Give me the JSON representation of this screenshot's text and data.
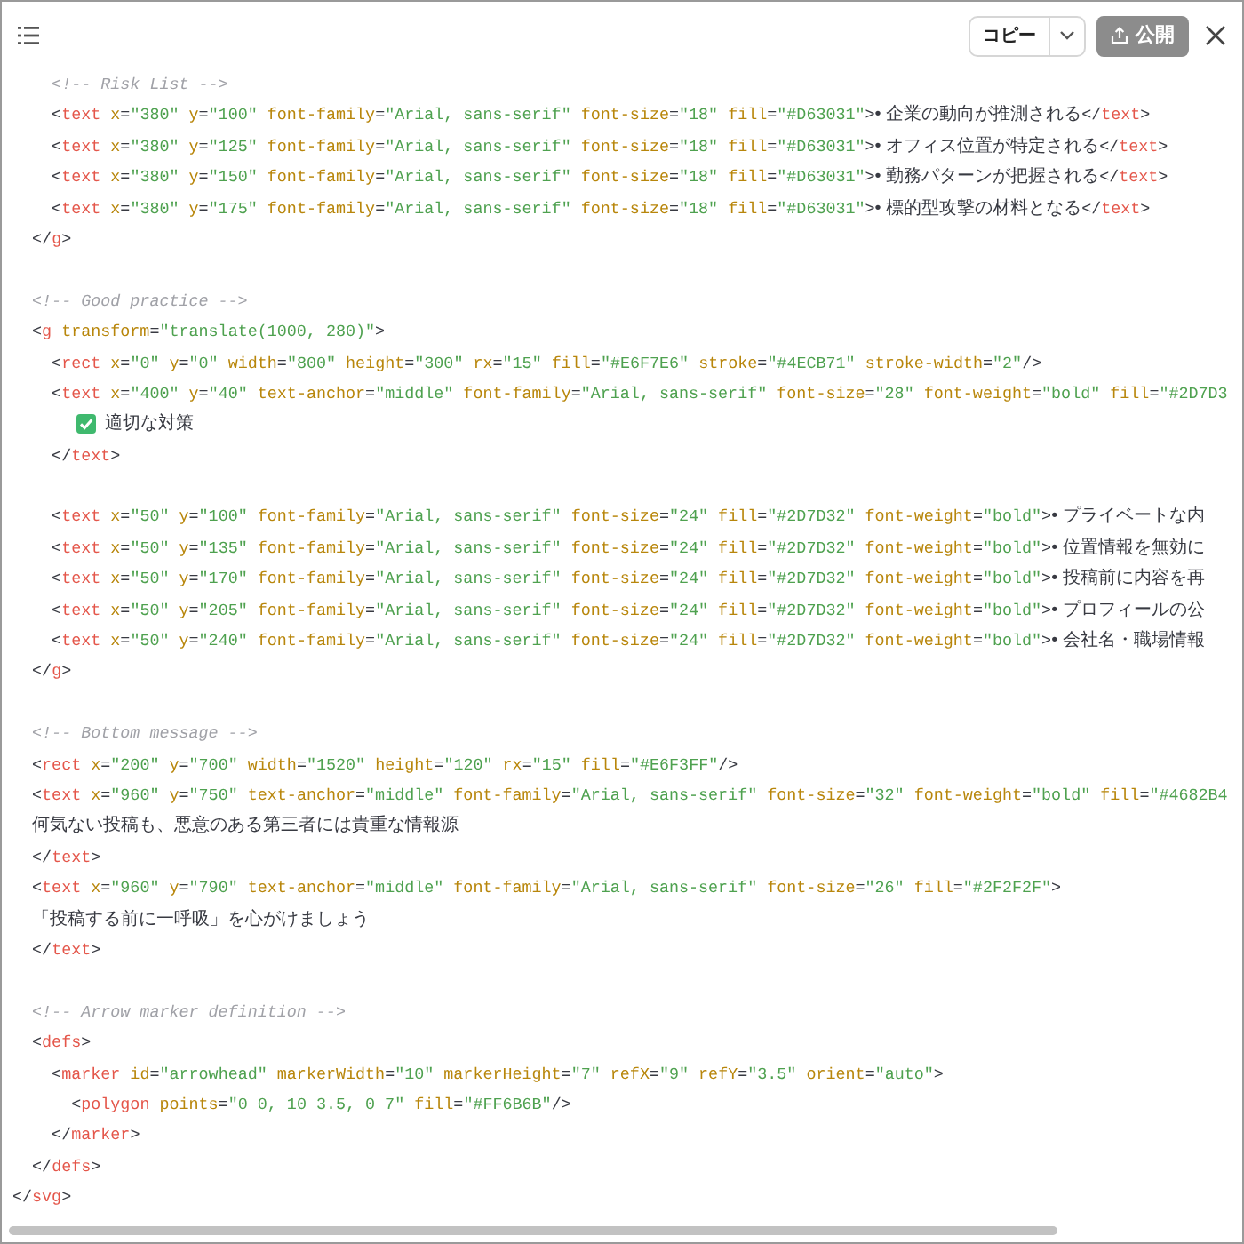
{
  "toolbar": {
    "copy_button": "コピー",
    "publish_button": "公開"
  },
  "code_lines": [
    {
      "kind": "code",
      "tokens": [
        {
          "kind": "comment",
          "text": "    <!-- Risk List -->"
        }
      ]
    },
    {
      "kind": "code",
      "tokens": [
        {
          "kind": "punct",
          "text": "    <"
        },
        {
          "kind": "tag",
          "text": "text"
        },
        {
          "kind": "attr",
          "text": " x"
        },
        {
          "kind": "punct",
          "text": "="
        },
        {
          "kind": "value",
          "text": "\"380\""
        },
        {
          "kind": "attr",
          "text": " y"
        },
        {
          "kind": "punct",
          "text": "="
        },
        {
          "kind": "value",
          "text": "\"100\""
        },
        {
          "kind": "attr",
          "text": " font-family"
        },
        {
          "kind": "punct",
          "text": "="
        },
        {
          "kind": "value",
          "text": "\"Arial, sans-serif\""
        },
        {
          "kind": "attr",
          "text": " font-size"
        },
        {
          "kind": "punct",
          "text": "="
        },
        {
          "kind": "value",
          "text": "\"18\""
        },
        {
          "kind": "attr",
          "text": " fill"
        },
        {
          "kind": "punct",
          "text": "="
        },
        {
          "kind": "value",
          "text": "\"#D63031\""
        },
        {
          "kind": "punct",
          "text": ">"
        },
        {
          "kind": "text",
          "text": "• 企業の動向が推測される"
        },
        {
          "kind": "punct",
          "text": "</"
        },
        {
          "kind": "tag",
          "text": "text"
        },
        {
          "kind": "punct",
          "text": ">"
        }
      ]
    },
    {
      "kind": "code",
      "tokens": [
        {
          "kind": "punct",
          "text": "    <"
        },
        {
          "kind": "tag",
          "text": "text"
        },
        {
          "kind": "attr",
          "text": " x"
        },
        {
          "kind": "punct",
          "text": "="
        },
        {
          "kind": "value",
          "text": "\"380\""
        },
        {
          "kind": "attr",
          "text": " y"
        },
        {
          "kind": "punct",
          "text": "="
        },
        {
          "kind": "value",
          "text": "\"125\""
        },
        {
          "kind": "attr",
          "text": " font-family"
        },
        {
          "kind": "punct",
          "text": "="
        },
        {
          "kind": "value",
          "text": "\"Arial, sans-serif\""
        },
        {
          "kind": "attr",
          "text": " font-size"
        },
        {
          "kind": "punct",
          "text": "="
        },
        {
          "kind": "value",
          "text": "\"18\""
        },
        {
          "kind": "attr",
          "text": " fill"
        },
        {
          "kind": "punct",
          "text": "="
        },
        {
          "kind": "value",
          "text": "\"#D63031\""
        },
        {
          "kind": "punct",
          "text": ">"
        },
        {
          "kind": "text",
          "text": "• オフィス位置が特定される"
        },
        {
          "kind": "punct",
          "text": "</"
        },
        {
          "kind": "tag",
          "text": "text"
        },
        {
          "kind": "punct",
          "text": ">"
        }
      ]
    },
    {
      "kind": "code",
      "tokens": [
        {
          "kind": "punct",
          "text": "    <"
        },
        {
          "kind": "tag",
          "text": "text"
        },
        {
          "kind": "attr",
          "text": " x"
        },
        {
          "kind": "punct",
          "text": "="
        },
        {
          "kind": "value",
          "text": "\"380\""
        },
        {
          "kind": "attr",
          "text": " y"
        },
        {
          "kind": "punct",
          "text": "="
        },
        {
          "kind": "value",
          "text": "\"150\""
        },
        {
          "kind": "attr",
          "text": " font-family"
        },
        {
          "kind": "punct",
          "text": "="
        },
        {
          "kind": "value",
          "text": "\"Arial, sans-serif\""
        },
        {
          "kind": "attr",
          "text": " font-size"
        },
        {
          "kind": "punct",
          "text": "="
        },
        {
          "kind": "value",
          "text": "\"18\""
        },
        {
          "kind": "attr",
          "text": " fill"
        },
        {
          "kind": "punct",
          "text": "="
        },
        {
          "kind": "value",
          "text": "\"#D63031\""
        },
        {
          "kind": "punct",
          "text": ">"
        },
        {
          "kind": "text",
          "text": "• 勤務パターンが把握される"
        },
        {
          "kind": "punct",
          "text": "</"
        },
        {
          "kind": "tag",
          "text": "text"
        },
        {
          "kind": "punct",
          "text": ">"
        }
      ]
    },
    {
      "kind": "code",
      "tokens": [
        {
          "kind": "punct",
          "text": "    <"
        },
        {
          "kind": "tag",
          "text": "text"
        },
        {
          "kind": "attr",
          "text": " x"
        },
        {
          "kind": "punct",
          "text": "="
        },
        {
          "kind": "value",
          "text": "\"380\""
        },
        {
          "kind": "attr",
          "text": " y"
        },
        {
          "kind": "punct",
          "text": "="
        },
        {
          "kind": "value",
          "text": "\"175\""
        },
        {
          "kind": "attr",
          "text": " font-family"
        },
        {
          "kind": "punct",
          "text": "="
        },
        {
          "kind": "value",
          "text": "\"Arial, sans-serif\""
        },
        {
          "kind": "attr",
          "text": " font-size"
        },
        {
          "kind": "punct",
          "text": "="
        },
        {
          "kind": "value",
          "text": "\"18\""
        },
        {
          "kind": "attr",
          "text": " fill"
        },
        {
          "kind": "punct",
          "text": "="
        },
        {
          "kind": "value",
          "text": "\"#D63031\""
        },
        {
          "kind": "punct",
          "text": ">"
        },
        {
          "kind": "text",
          "text": "• 標的型攻撃の材料となる"
        },
        {
          "kind": "punct",
          "text": "</"
        },
        {
          "kind": "tag",
          "text": "text"
        },
        {
          "kind": "punct",
          "text": ">"
        }
      ]
    },
    {
      "kind": "code",
      "tokens": [
        {
          "kind": "punct",
          "text": "  </"
        },
        {
          "kind": "tag",
          "text": "g"
        },
        {
          "kind": "punct",
          "text": ">"
        }
      ]
    },
    {
      "kind": "blank"
    },
    {
      "kind": "code",
      "tokens": [
        {
          "kind": "comment",
          "text": "  <!-- Good practice -->"
        }
      ]
    },
    {
      "kind": "code",
      "tokens": [
        {
          "kind": "punct",
          "text": "  <"
        },
        {
          "kind": "tag",
          "text": "g"
        },
        {
          "kind": "attr",
          "text": " transform"
        },
        {
          "kind": "punct",
          "text": "="
        },
        {
          "kind": "value",
          "text": "\"translate(1000, 280)\""
        },
        {
          "kind": "punct",
          "text": ">"
        }
      ]
    },
    {
      "kind": "code",
      "tokens": [
        {
          "kind": "punct",
          "text": "    <"
        },
        {
          "kind": "tag",
          "text": "rect"
        },
        {
          "kind": "attr",
          "text": " x"
        },
        {
          "kind": "punct",
          "text": "="
        },
        {
          "kind": "value",
          "text": "\"0\""
        },
        {
          "kind": "attr",
          "text": " y"
        },
        {
          "kind": "punct",
          "text": "="
        },
        {
          "kind": "value",
          "text": "\"0\""
        },
        {
          "kind": "attr",
          "text": " width"
        },
        {
          "kind": "punct",
          "text": "="
        },
        {
          "kind": "value",
          "text": "\"800\""
        },
        {
          "kind": "attr",
          "text": " height"
        },
        {
          "kind": "punct",
          "text": "="
        },
        {
          "kind": "value",
          "text": "\"300\""
        },
        {
          "kind": "attr",
          "text": " rx"
        },
        {
          "kind": "punct",
          "text": "="
        },
        {
          "kind": "value",
          "text": "\"15\""
        },
        {
          "kind": "attr",
          "text": " fill"
        },
        {
          "kind": "punct",
          "text": "="
        },
        {
          "kind": "value",
          "text": "\"#E6F7E6\""
        },
        {
          "kind": "attr",
          "text": " stroke"
        },
        {
          "kind": "punct",
          "text": "="
        },
        {
          "kind": "value",
          "text": "\"#4ECB71\""
        },
        {
          "kind": "attr",
          "text": " stroke-width"
        },
        {
          "kind": "punct",
          "text": "="
        },
        {
          "kind": "value",
          "text": "\"2\""
        },
        {
          "kind": "punct",
          "text": "/>"
        }
      ]
    },
    {
      "kind": "code",
      "tokens": [
        {
          "kind": "punct",
          "text": "    <"
        },
        {
          "kind": "tag",
          "text": "text"
        },
        {
          "kind": "attr",
          "text": " x"
        },
        {
          "kind": "punct",
          "text": "="
        },
        {
          "kind": "value",
          "text": "\"400\""
        },
        {
          "kind": "attr",
          "text": " y"
        },
        {
          "kind": "punct",
          "text": "="
        },
        {
          "kind": "value",
          "text": "\"40\""
        },
        {
          "kind": "attr",
          "text": " text-anchor"
        },
        {
          "kind": "punct",
          "text": "="
        },
        {
          "kind": "value",
          "text": "\"middle\""
        },
        {
          "kind": "attr",
          "text": " font-family"
        },
        {
          "kind": "punct",
          "text": "="
        },
        {
          "kind": "value",
          "text": "\"Arial, sans-serif\""
        },
        {
          "kind": "attr",
          "text": " font-size"
        },
        {
          "kind": "punct",
          "text": "="
        },
        {
          "kind": "value",
          "text": "\"28\""
        },
        {
          "kind": "attr",
          "text": " font-weight"
        },
        {
          "kind": "punct",
          "text": "="
        },
        {
          "kind": "value",
          "text": "\"bold\""
        },
        {
          "kind": "attr",
          "text": " fill"
        },
        {
          "kind": "punct",
          "text": "="
        },
        {
          "kind": "value",
          "text": "\"#2D7D3"
        }
      ]
    },
    {
      "kind": "checked_label",
      "text": "適切な対策"
    },
    {
      "kind": "code",
      "tokens": [
        {
          "kind": "punct",
          "text": "    </"
        },
        {
          "kind": "tag",
          "text": "text"
        },
        {
          "kind": "punct",
          "text": ">"
        }
      ]
    },
    {
      "kind": "blank"
    },
    {
      "kind": "code",
      "tokens": [
        {
          "kind": "punct",
          "text": "    <"
        },
        {
          "kind": "tag",
          "text": "text"
        },
        {
          "kind": "attr",
          "text": " x"
        },
        {
          "kind": "punct",
          "text": "="
        },
        {
          "kind": "value",
          "text": "\"50\""
        },
        {
          "kind": "attr",
          "text": " y"
        },
        {
          "kind": "punct",
          "text": "="
        },
        {
          "kind": "value",
          "text": "\"100\""
        },
        {
          "kind": "attr",
          "text": " font-family"
        },
        {
          "kind": "punct",
          "text": "="
        },
        {
          "kind": "value",
          "text": "\"Arial, sans-serif\""
        },
        {
          "kind": "attr",
          "text": " font-size"
        },
        {
          "kind": "punct",
          "text": "="
        },
        {
          "kind": "value",
          "text": "\"24\""
        },
        {
          "kind": "attr",
          "text": " fill"
        },
        {
          "kind": "punct",
          "text": "="
        },
        {
          "kind": "value",
          "text": "\"#2D7D32\""
        },
        {
          "kind": "attr",
          "text": " font-weight"
        },
        {
          "kind": "punct",
          "text": "="
        },
        {
          "kind": "value",
          "text": "\"bold\""
        },
        {
          "kind": "punct",
          "text": ">"
        },
        {
          "kind": "text",
          "text": "• プライベートな内"
        }
      ]
    },
    {
      "kind": "code",
      "tokens": [
        {
          "kind": "punct",
          "text": "    <"
        },
        {
          "kind": "tag",
          "text": "text"
        },
        {
          "kind": "attr",
          "text": " x"
        },
        {
          "kind": "punct",
          "text": "="
        },
        {
          "kind": "value",
          "text": "\"50\""
        },
        {
          "kind": "attr",
          "text": " y"
        },
        {
          "kind": "punct",
          "text": "="
        },
        {
          "kind": "value",
          "text": "\"135\""
        },
        {
          "kind": "attr",
          "text": " font-family"
        },
        {
          "kind": "punct",
          "text": "="
        },
        {
          "kind": "value",
          "text": "\"Arial, sans-serif\""
        },
        {
          "kind": "attr",
          "text": " font-size"
        },
        {
          "kind": "punct",
          "text": "="
        },
        {
          "kind": "value",
          "text": "\"24\""
        },
        {
          "kind": "attr",
          "text": " fill"
        },
        {
          "kind": "punct",
          "text": "="
        },
        {
          "kind": "value",
          "text": "\"#2D7D32\""
        },
        {
          "kind": "attr",
          "text": " font-weight"
        },
        {
          "kind": "punct",
          "text": "="
        },
        {
          "kind": "value",
          "text": "\"bold\""
        },
        {
          "kind": "punct",
          "text": ">"
        },
        {
          "kind": "text",
          "text": "• 位置情報を無効に"
        }
      ]
    },
    {
      "kind": "code",
      "tokens": [
        {
          "kind": "punct",
          "text": "    <"
        },
        {
          "kind": "tag",
          "text": "text"
        },
        {
          "kind": "attr",
          "text": " x"
        },
        {
          "kind": "punct",
          "text": "="
        },
        {
          "kind": "value",
          "text": "\"50\""
        },
        {
          "kind": "attr",
          "text": " y"
        },
        {
          "kind": "punct",
          "text": "="
        },
        {
          "kind": "value",
          "text": "\"170\""
        },
        {
          "kind": "attr",
          "text": " font-family"
        },
        {
          "kind": "punct",
          "text": "="
        },
        {
          "kind": "value",
          "text": "\"Arial, sans-serif\""
        },
        {
          "kind": "attr",
          "text": " font-size"
        },
        {
          "kind": "punct",
          "text": "="
        },
        {
          "kind": "value",
          "text": "\"24\""
        },
        {
          "kind": "attr",
          "text": " fill"
        },
        {
          "kind": "punct",
          "text": "="
        },
        {
          "kind": "value",
          "text": "\"#2D7D32\""
        },
        {
          "kind": "attr",
          "text": " font-weight"
        },
        {
          "kind": "punct",
          "text": "="
        },
        {
          "kind": "value",
          "text": "\"bold\""
        },
        {
          "kind": "punct",
          "text": ">"
        },
        {
          "kind": "text",
          "text": "• 投稿前に内容を再"
        }
      ]
    },
    {
      "kind": "code",
      "tokens": [
        {
          "kind": "punct",
          "text": "    <"
        },
        {
          "kind": "tag",
          "text": "text"
        },
        {
          "kind": "attr",
          "text": " x"
        },
        {
          "kind": "punct",
          "text": "="
        },
        {
          "kind": "value",
          "text": "\"50\""
        },
        {
          "kind": "attr",
          "text": " y"
        },
        {
          "kind": "punct",
          "text": "="
        },
        {
          "kind": "value",
          "text": "\"205\""
        },
        {
          "kind": "attr",
          "text": " font-family"
        },
        {
          "kind": "punct",
          "text": "="
        },
        {
          "kind": "value",
          "text": "\"Arial, sans-serif\""
        },
        {
          "kind": "attr",
          "text": " font-size"
        },
        {
          "kind": "punct",
          "text": "="
        },
        {
          "kind": "value",
          "text": "\"24\""
        },
        {
          "kind": "attr",
          "text": " fill"
        },
        {
          "kind": "punct",
          "text": "="
        },
        {
          "kind": "value",
          "text": "\"#2D7D32\""
        },
        {
          "kind": "attr",
          "text": " font-weight"
        },
        {
          "kind": "punct",
          "text": "="
        },
        {
          "kind": "value",
          "text": "\"bold\""
        },
        {
          "kind": "punct",
          "text": ">"
        },
        {
          "kind": "text",
          "text": "• プロフィールの公"
        }
      ]
    },
    {
      "kind": "code",
      "tokens": [
        {
          "kind": "punct",
          "text": "    <"
        },
        {
          "kind": "tag",
          "text": "text"
        },
        {
          "kind": "attr",
          "text": " x"
        },
        {
          "kind": "punct",
          "text": "="
        },
        {
          "kind": "value",
          "text": "\"50\""
        },
        {
          "kind": "attr",
          "text": " y"
        },
        {
          "kind": "punct",
          "text": "="
        },
        {
          "kind": "value",
          "text": "\"240\""
        },
        {
          "kind": "attr",
          "text": " font-family"
        },
        {
          "kind": "punct",
          "text": "="
        },
        {
          "kind": "value",
          "text": "\"Arial, sans-serif\""
        },
        {
          "kind": "attr",
          "text": " font-size"
        },
        {
          "kind": "punct",
          "text": "="
        },
        {
          "kind": "value",
          "text": "\"24\""
        },
        {
          "kind": "attr",
          "text": " fill"
        },
        {
          "kind": "punct",
          "text": "="
        },
        {
          "kind": "value",
          "text": "\"#2D7D32\""
        },
        {
          "kind": "attr",
          "text": " font-weight"
        },
        {
          "kind": "punct",
          "text": "="
        },
        {
          "kind": "value",
          "text": "\"bold\""
        },
        {
          "kind": "punct",
          "text": ">"
        },
        {
          "kind": "text",
          "text": "• 会社名・職場情報"
        }
      ]
    },
    {
      "kind": "code",
      "tokens": [
        {
          "kind": "punct",
          "text": "  </"
        },
        {
          "kind": "tag",
          "text": "g"
        },
        {
          "kind": "punct",
          "text": ">"
        }
      ]
    },
    {
      "kind": "blank"
    },
    {
      "kind": "code",
      "tokens": [
        {
          "kind": "comment",
          "text": "  <!-- Bottom message -->"
        }
      ]
    },
    {
      "kind": "code",
      "tokens": [
        {
          "kind": "punct",
          "text": "  <"
        },
        {
          "kind": "tag",
          "text": "rect"
        },
        {
          "kind": "attr",
          "text": " x"
        },
        {
          "kind": "punct",
          "text": "="
        },
        {
          "kind": "value",
          "text": "\"200\""
        },
        {
          "kind": "attr",
          "text": " y"
        },
        {
          "kind": "punct",
          "text": "="
        },
        {
          "kind": "value",
          "text": "\"700\""
        },
        {
          "kind": "attr",
          "text": " width"
        },
        {
          "kind": "punct",
          "text": "="
        },
        {
          "kind": "value",
          "text": "\"1520\""
        },
        {
          "kind": "attr",
          "text": " height"
        },
        {
          "kind": "punct",
          "text": "="
        },
        {
          "kind": "value",
          "text": "\"120\""
        },
        {
          "kind": "attr",
          "text": " rx"
        },
        {
          "kind": "punct",
          "text": "="
        },
        {
          "kind": "value",
          "text": "\"15\""
        },
        {
          "kind": "attr",
          "text": " fill"
        },
        {
          "kind": "punct",
          "text": "="
        },
        {
          "kind": "value",
          "text": "\"#E6F3FF\""
        },
        {
          "kind": "punct",
          "text": "/>"
        }
      ]
    },
    {
      "kind": "code",
      "tokens": [
        {
          "kind": "punct",
          "text": "  <"
        },
        {
          "kind": "tag",
          "text": "text"
        },
        {
          "kind": "attr",
          "text": " x"
        },
        {
          "kind": "punct",
          "text": "="
        },
        {
          "kind": "value",
          "text": "\"960\""
        },
        {
          "kind": "attr",
          "text": " y"
        },
        {
          "kind": "punct",
          "text": "="
        },
        {
          "kind": "value",
          "text": "\"750\""
        },
        {
          "kind": "attr",
          "text": " text-anchor"
        },
        {
          "kind": "punct",
          "text": "="
        },
        {
          "kind": "value",
          "text": "\"middle\""
        },
        {
          "kind": "attr",
          "text": " font-family"
        },
        {
          "kind": "punct",
          "text": "="
        },
        {
          "kind": "value",
          "text": "\"Arial, sans-serif\""
        },
        {
          "kind": "attr",
          "text": " font-size"
        },
        {
          "kind": "punct",
          "text": "="
        },
        {
          "kind": "value",
          "text": "\"32\""
        },
        {
          "kind": "attr",
          "text": " font-weight"
        },
        {
          "kind": "punct",
          "text": "="
        },
        {
          "kind": "value",
          "text": "\"bold\""
        },
        {
          "kind": "attr",
          "text": " fill"
        },
        {
          "kind": "punct",
          "text": "="
        },
        {
          "kind": "value",
          "text": "\"#4682B4"
        }
      ]
    },
    {
      "kind": "code",
      "tokens": [
        {
          "kind": "text",
          "text": "    何気ない投稿も、悪意のある第三者には貴重な情報源"
        }
      ]
    },
    {
      "kind": "code",
      "tokens": [
        {
          "kind": "punct",
          "text": "  </"
        },
        {
          "kind": "tag",
          "text": "text"
        },
        {
          "kind": "punct",
          "text": ">"
        }
      ]
    },
    {
      "kind": "code",
      "tokens": [
        {
          "kind": "punct",
          "text": "  <"
        },
        {
          "kind": "tag",
          "text": "text"
        },
        {
          "kind": "attr",
          "text": " x"
        },
        {
          "kind": "punct",
          "text": "="
        },
        {
          "kind": "value",
          "text": "\"960\""
        },
        {
          "kind": "attr",
          "text": " y"
        },
        {
          "kind": "punct",
          "text": "="
        },
        {
          "kind": "value",
          "text": "\"790\""
        },
        {
          "kind": "attr",
          "text": " text-anchor"
        },
        {
          "kind": "punct",
          "text": "="
        },
        {
          "kind": "value",
          "text": "\"middle\""
        },
        {
          "kind": "attr",
          "text": " font-family"
        },
        {
          "kind": "punct",
          "text": "="
        },
        {
          "kind": "value",
          "text": "\"Arial, sans-serif\""
        },
        {
          "kind": "attr",
          "text": " font-size"
        },
        {
          "kind": "punct",
          "text": "="
        },
        {
          "kind": "value",
          "text": "\"26\""
        },
        {
          "kind": "attr",
          "text": " fill"
        },
        {
          "kind": "punct",
          "text": "="
        },
        {
          "kind": "value",
          "text": "\"#2F2F2F\""
        },
        {
          "kind": "punct",
          "text": ">"
        }
      ]
    },
    {
      "kind": "code",
      "tokens": [
        {
          "kind": "text",
          "text": "    「投稿する前に一呼吸」を心がけましょう"
        }
      ]
    },
    {
      "kind": "code",
      "tokens": [
        {
          "kind": "punct",
          "text": "  </"
        },
        {
          "kind": "tag",
          "text": "text"
        },
        {
          "kind": "punct",
          "text": ">"
        }
      ]
    },
    {
      "kind": "blank"
    },
    {
      "kind": "code",
      "tokens": [
        {
          "kind": "comment",
          "text": "  <!-- Arrow marker definition -->"
        }
      ]
    },
    {
      "kind": "code",
      "tokens": [
        {
          "kind": "punct",
          "text": "  <"
        },
        {
          "kind": "tag",
          "text": "defs"
        },
        {
          "kind": "punct",
          "text": ">"
        }
      ]
    },
    {
      "kind": "code",
      "tokens": [
        {
          "kind": "punct",
          "text": "    <"
        },
        {
          "kind": "tag",
          "text": "marker"
        },
        {
          "kind": "attr",
          "text": " id"
        },
        {
          "kind": "punct",
          "text": "="
        },
        {
          "kind": "value",
          "text": "\"arrowhead\""
        },
        {
          "kind": "attr",
          "text": " markerWidth"
        },
        {
          "kind": "punct",
          "text": "="
        },
        {
          "kind": "value",
          "text": "\"10\""
        },
        {
          "kind": "attr",
          "text": " markerHeight"
        },
        {
          "kind": "punct",
          "text": "="
        },
        {
          "kind": "value",
          "text": "\"7\""
        },
        {
          "kind": "attr",
          "text": " refX"
        },
        {
          "kind": "punct",
          "text": "="
        },
        {
          "kind": "value",
          "text": "\"9\""
        },
        {
          "kind": "attr",
          "text": " refY"
        },
        {
          "kind": "punct",
          "text": "="
        },
        {
          "kind": "value",
          "text": "\"3.5\""
        },
        {
          "kind": "attr",
          "text": " orient"
        },
        {
          "kind": "punct",
          "text": "="
        },
        {
          "kind": "value",
          "text": "\"auto\""
        },
        {
          "kind": "punct",
          "text": ">"
        }
      ]
    },
    {
      "kind": "code",
      "tokens": [
        {
          "kind": "punct",
          "text": "      <"
        },
        {
          "kind": "tag",
          "text": "polygon"
        },
        {
          "kind": "attr",
          "text": " points"
        },
        {
          "kind": "punct",
          "text": "="
        },
        {
          "kind": "value",
          "text": "\"0 0, 10 3.5, 0 7\""
        },
        {
          "kind": "attr",
          "text": " fill"
        },
        {
          "kind": "punct",
          "text": "="
        },
        {
          "kind": "value",
          "text": "\"#FF6B6B\""
        },
        {
          "kind": "punct",
          "text": "/>"
        }
      ]
    },
    {
      "kind": "code",
      "tokens": [
        {
          "kind": "punct",
          "text": "    </"
        },
        {
          "kind": "tag",
          "text": "marker"
        },
        {
          "kind": "punct",
          "text": ">"
        }
      ]
    },
    {
      "kind": "code",
      "tokens": [
        {
          "kind": "punct",
          "text": "  </"
        },
        {
          "kind": "tag",
          "text": "defs"
        },
        {
          "kind": "punct",
          "text": ">"
        }
      ]
    },
    {
      "kind": "code",
      "tokens": [
        {
          "kind": "punct",
          "text": "</"
        },
        {
          "kind": "tag",
          "text": "svg"
        },
        {
          "kind": "punct",
          "text": ">"
        }
      ]
    }
  ]
}
